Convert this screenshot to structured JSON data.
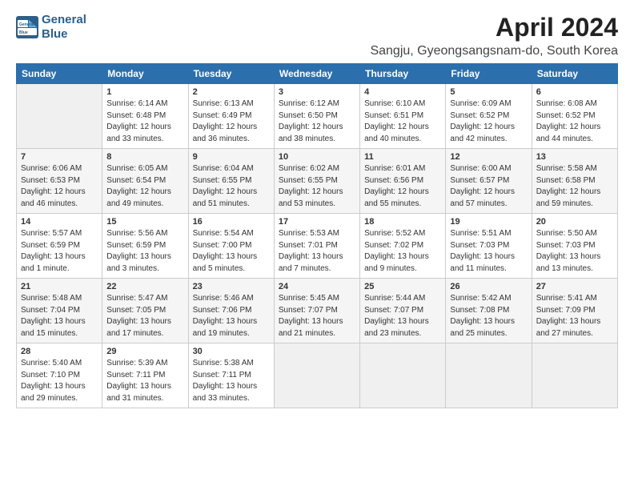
{
  "header": {
    "logo_line1": "General",
    "logo_line2": "Blue",
    "title": "April 2024",
    "subtitle": "Sangju, Gyeongsangsnam-do, South Korea"
  },
  "columns": [
    "Sunday",
    "Monday",
    "Tuesday",
    "Wednesday",
    "Thursday",
    "Friday",
    "Saturday"
  ],
  "weeks": [
    [
      {
        "day": "",
        "text": ""
      },
      {
        "day": "1",
        "text": "Sunrise: 6:14 AM\nSunset: 6:48 PM\nDaylight: 12 hours\nand 33 minutes."
      },
      {
        "day": "2",
        "text": "Sunrise: 6:13 AM\nSunset: 6:49 PM\nDaylight: 12 hours\nand 36 minutes."
      },
      {
        "day": "3",
        "text": "Sunrise: 6:12 AM\nSunset: 6:50 PM\nDaylight: 12 hours\nand 38 minutes."
      },
      {
        "day": "4",
        "text": "Sunrise: 6:10 AM\nSunset: 6:51 PM\nDaylight: 12 hours\nand 40 minutes."
      },
      {
        "day": "5",
        "text": "Sunrise: 6:09 AM\nSunset: 6:52 PM\nDaylight: 12 hours\nand 42 minutes."
      },
      {
        "day": "6",
        "text": "Sunrise: 6:08 AM\nSunset: 6:52 PM\nDaylight: 12 hours\nand 44 minutes."
      }
    ],
    [
      {
        "day": "7",
        "text": "Sunrise: 6:06 AM\nSunset: 6:53 PM\nDaylight: 12 hours\nand 46 minutes."
      },
      {
        "day": "8",
        "text": "Sunrise: 6:05 AM\nSunset: 6:54 PM\nDaylight: 12 hours\nand 49 minutes."
      },
      {
        "day": "9",
        "text": "Sunrise: 6:04 AM\nSunset: 6:55 PM\nDaylight: 12 hours\nand 51 minutes."
      },
      {
        "day": "10",
        "text": "Sunrise: 6:02 AM\nSunset: 6:55 PM\nDaylight: 12 hours\nand 53 minutes."
      },
      {
        "day": "11",
        "text": "Sunrise: 6:01 AM\nSunset: 6:56 PM\nDaylight: 12 hours\nand 55 minutes."
      },
      {
        "day": "12",
        "text": "Sunrise: 6:00 AM\nSunset: 6:57 PM\nDaylight: 12 hours\nand 57 minutes."
      },
      {
        "day": "13",
        "text": "Sunrise: 5:58 AM\nSunset: 6:58 PM\nDaylight: 12 hours\nand 59 minutes."
      }
    ],
    [
      {
        "day": "14",
        "text": "Sunrise: 5:57 AM\nSunset: 6:59 PM\nDaylight: 13 hours\nand 1 minute."
      },
      {
        "day": "15",
        "text": "Sunrise: 5:56 AM\nSunset: 6:59 PM\nDaylight: 13 hours\nand 3 minutes."
      },
      {
        "day": "16",
        "text": "Sunrise: 5:54 AM\nSunset: 7:00 PM\nDaylight: 13 hours\nand 5 minutes."
      },
      {
        "day": "17",
        "text": "Sunrise: 5:53 AM\nSunset: 7:01 PM\nDaylight: 13 hours\nand 7 minutes."
      },
      {
        "day": "18",
        "text": "Sunrise: 5:52 AM\nSunset: 7:02 PM\nDaylight: 13 hours\nand 9 minutes."
      },
      {
        "day": "19",
        "text": "Sunrise: 5:51 AM\nSunset: 7:03 PM\nDaylight: 13 hours\nand 11 minutes."
      },
      {
        "day": "20",
        "text": "Sunrise: 5:50 AM\nSunset: 7:03 PM\nDaylight: 13 hours\nand 13 minutes."
      }
    ],
    [
      {
        "day": "21",
        "text": "Sunrise: 5:48 AM\nSunset: 7:04 PM\nDaylight: 13 hours\nand 15 minutes."
      },
      {
        "day": "22",
        "text": "Sunrise: 5:47 AM\nSunset: 7:05 PM\nDaylight: 13 hours\nand 17 minutes."
      },
      {
        "day": "23",
        "text": "Sunrise: 5:46 AM\nSunset: 7:06 PM\nDaylight: 13 hours\nand 19 minutes."
      },
      {
        "day": "24",
        "text": "Sunrise: 5:45 AM\nSunset: 7:07 PM\nDaylight: 13 hours\nand 21 minutes."
      },
      {
        "day": "25",
        "text": "Sunrise: 5:44 AM\nSunset: 7:07 PM\nDaylight: 13 hours\nand 23 minutes."
      },
      {
        "day": "26",
        "text": "Sunrise: 5:42 AM\nSunset: 7:08 PM\nDaylight: 13 hours\nand 25 minutes."
      },
      {
        "day": "27",
        "text": "Sunrise: 5:41 AM\nSunset: 7:09 PM\nDaylight: 13 hours\nand 27 minutes."
      }
    ],
    [
      {
        "day": "28",
        "text": "Sunrise: 5:40 AM\nSunset: 7:10 PM\nDaylight: 13 hours\nand 29 minutes."
      },
      {
        "day": "29",
        "text": "Sunrise: 5:39 AM\nSunset: 7:11 PM\nDaylight: 13 hours\nand 31 minutes."
      },
      {
        "day": "30",
        "text": "Sunrise: 5:38 AM\nSunset: 7:11 PM\nDaylight: 13 hours\nand 33 minutes."
      },
      {
        "day": "",
        "text": ""
      },
      {
        "day": "",
        "text": ""
      },
      {
        "day": "",
        "text": ""
      },
      {
        "day": "",
        "text": ""
      }
    ]
  ]
}
